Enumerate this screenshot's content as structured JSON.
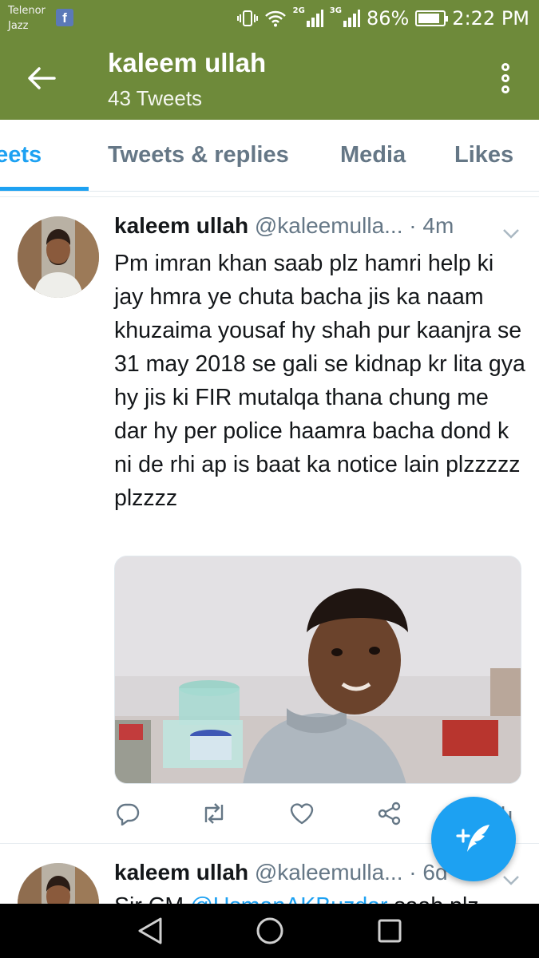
{
  "status_bar": {
    "carrier_line1": "Telenor",
    "carrier_line2": "Jazz",
    "facebook_badge": "f",
    "network_2g": "2G",
    "network_3g": "3G",
    "battery_percent": "86%",
    "battery_level": 0.86,
    "time": "2:22 PM"
  },
  "header": {
    "name": "kaleem ullah",
    "tweet_count": "43 Tweets"
  },
  "tabs": [
    {
      "label": "Tweets",
      "active": true
    },
    {
      "label": "Tweets & replies",
      "active": false
    },
    {
      "label": "Media",
      "active": false
    },
    {
      "label": "Likes",
      "active": false
    }
  ],
  "tweets": [
    {
      "author": "kaleem ullah",
      "handle": "@kaleemulla...",
      "time": "· 4m",
      "text": "Pm imran khan saab plz hamri help ki jay hmra ye chuta bacha jis ka naam khuzaima yousaf hy shah pur kaanjra se 31 may 2018 se gali se kidnap kr lita gya hy jis ki FIR mutalqa thana chung me dar hy per police haamra bacha dond k ni de rhi ap is baat ka notice lain plzzzzz plzzzz"
    },
    {
      "author": "kaleem ullah",
      "handle": "@kaleemulla...",
      "time": "· 6d",
      "text_prefix": "Sir CM ",
      "mention": "@UsmanAKBuzdar",
      "text_suffix": " saab plz"
    }
  ],
  "colors": {
    "app_bar": "#6e8a3a",
    "accent": "#1da1f2",
    "secondary_text": "#657786"
  },
  "icons": {
    "back": "arrow-left-icon",
    "overflow": "more-vertical-icon",
    "reply": "reply-icon",
    "retweet": "retweet-icon",
    "like": "heart-icon",
    "share": "share-icon",
    "analytics": "analytics-icon",
    "compose": "compose-tweet-icon"
  }
}
